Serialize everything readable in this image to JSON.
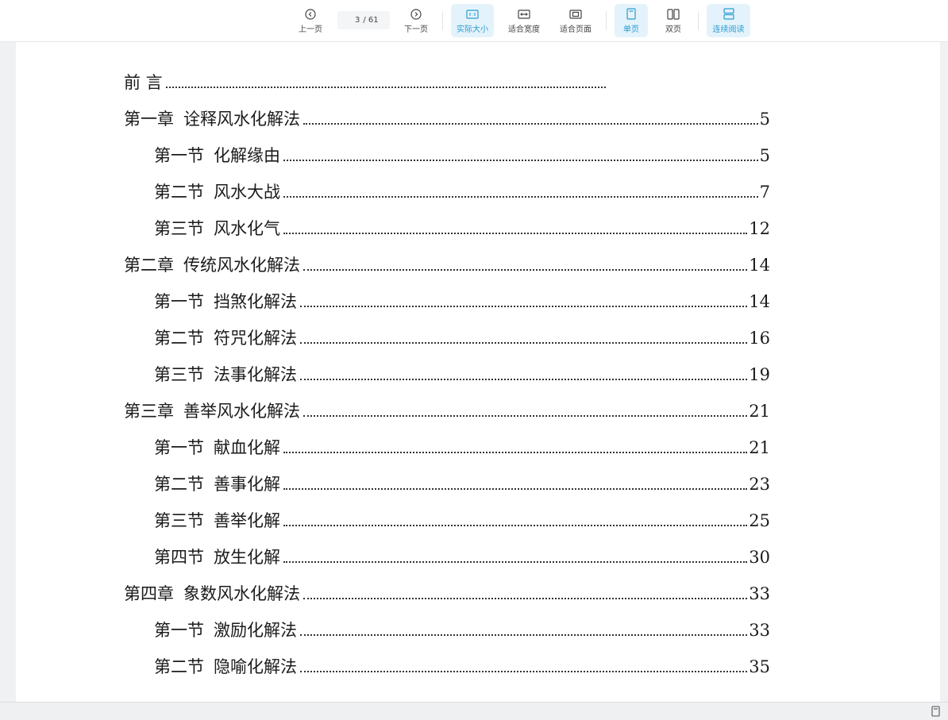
{
  "toolbar": {
    "prev_label": "上一页",
    "next_label": "下一页",
    "current_page": "3",
    "total_pages": "/ 61",
    "actual_size_label": "实际大小",
    "fit_width_label": "适合宽度",
    "fit_page_label": "适合页面",
    "single_page_label": "单页",
    "double_page_label": "双页",
    "continuous_label": "连续阅读",
    "accent_color": "#2a9bd0"
  },
  "toc": [
    {
      "section": "前  言",
      "title": "",
      "page": "",
      "level": 0
    },
    {
      "section": "第一章",
      "title": "诠释风水化解法",
      "page": "5",
      "level": 0
    },
    {
      "section": "第一节",
      "title": "化解缘由",
      "page": "5",
      "level": 1
    },
    {
      "section": "第二节",
      "title": "风水大战",
      "page": "7",
      "level": 1
    },
    {
      "section": "第三节",
      "title": "风水化气",
      "page": "12",
      "level": 1
    },
    {
      "section": "第二章",
      "title": "传统风水化解法",
      "page": "14",
      "level": 0
    },
    {
      "section": "第一节",
      "title": "挡煞化解法",
      "page": "14",
      "level": 1
    },
    {
      "section": "第二节",
      "title": "符咒化解法",
      "page": "16",
      "level": 1
    },
    {
      "section": "第三节",
      "title": "法事化解法",
      "page": "19",
      "level": 1
    },
    {
      "section": "第三章",
      "title": "善举风水化解法",
      "page": "21",
      "level": 0
    },
    {
      "section": "第一节",
      "title": "献血化解",
      "page": "21",
      "level": 1
    },
    {
      "section": "第二节",
      "title": "善事化解",
      "page": "23",
      "level": 1
    },
    {
      "section": "第三节",
      "title": "善举化解",
      "page": "25",
      "level": 1
    },
    {
      "section": "第四节",
      "title": "放生化解",
      "page": "30",
      "level": 1
    },
    {
      "section": "第四章",
      "title": "象数风水化解法",
      "page": "33",
      "level": 0
    },
    {
      "section": "第一节",
      "title": "激励化解法",
      "page": "33",
      "level": 1
    },
    {
      "section": "第二节",
      "title": "隐喻化解法",
      "page": "35",
      "level": 1
    }
  ]
}
